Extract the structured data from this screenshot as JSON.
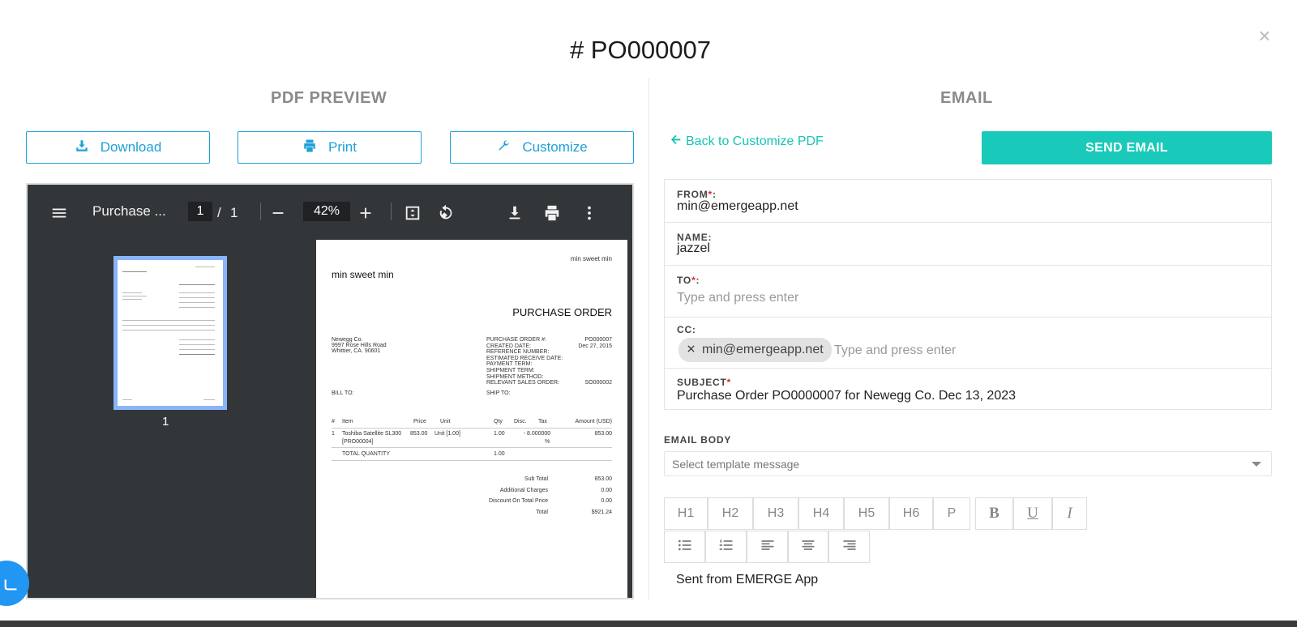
{
  "modal": {
    "title": "# PO000007",
    "close_symbol": "×"
  },
  "pdf": {
    "section_title": "PDF PREVIEW",
    "buttons": {
      "download": "Download",
      "print": "Print",
      "customize": "Customize"
    },
    "viewer": {
      "doc_title": "Purchase ...",
      "page_current": "1",
      "page_sep": "/",
      "page_total": "1",
      "zoom": "42%",
      "minus": "—",
      "plus": "+",
      "thumb_label": "1"
    },
    "doc": {
      "company_top": "min sweet min",
      "company": "min sweet min",
      "heading": "PURCHASE ORDER",
      "vendor": [
        "Newegg Co.",
        "9997 Rose Hills Road",
        "Whittier, CA. 90601"
      ],
      "meta_labels": [
        "PURCHASE ORDER #:",
        "CREATED DATE:",
        "REFERENCE NUMBER:",
        "ESTIMATED RECEIVE DATE:",
        "PAYMENT TERM:",
        "SHIPMENT TERM:",
        "SHIPMENT METHOD:",
        "RELEVANT SALES ORDER:"
      ],
      "meta_values": [
        "PO000007",
        "Dec 27, 2015",
        "",
        "",
        "",
        "",
        "",
        "SO000002"
      ],
      "bill_to": "BILL TO:",
      "ship_to": "SHIP TO:",
      "columns": [
        "#",
        "Item",
        "Price",
        "Unit",
        "Qty",
        "Disc.",
        "Tax",
        "Amount (USD)"
      ],
      "row": [
        "1",
        "Toshiba Satellite SL300",
        "853.00",
        "Unit [1.00]",
        "1.00",
        "-",
        "8.000000",
        "853.00"
      ],
      "row_code": "[PRO00004]",
      "row_pct": "%",
      "total_qty_label": "TOTAL QUANTITY",
      "total_qty": "1.00",
      "summary_labels": [
        "Sub Total",
        "Additional Charges",
        "Discount On Total Price",
        "Total"
      ],
      "summary_values": [
        "853.00",
        "0.00",
        "0.00",
        "$921.24"
      ]
    }
  },
  "email": {
    "section_title": "EMAIL",
    "back_link": "Back to Customize PDF",
    "send_button": "SEND EMAIL",
    "from_label": "FROM",
    "from_value": "min@emergeapp.net",
    "name_label": "NAME:",
    "name_value": "jazzel",
    "to_label": "TO",
    "to_placeholder": "Type and press enter",
    "cc_label": "CC:",
    "cc_chip": "min@emergeapp.net",
    "cc_placeholder": "Type and press enter",
    "subject_label": "SUBJECT",
    "subject_value": "Purchase Order PO0000007 for Newegg Co. Dec 13, 2023",
    "required_mark": "*",
    "colon": ":",
    "body_label": "EMAIL BODY",
    "template_placeholder": "Select template message",
    "toolbar": [
      "H1",
      "H2",
      "H3",
      "H4",
      "H5",
      "H6",
      "P",
      "B",
      "U",
      "I"
    ],
    "body_text": "Sent from EMERGE App"
  },
  "colors": {
    "accent_blue": "#1ea0d8",
    "teal": "#19c9b9",
    "viewer_bg": "#323639"
  }
}
